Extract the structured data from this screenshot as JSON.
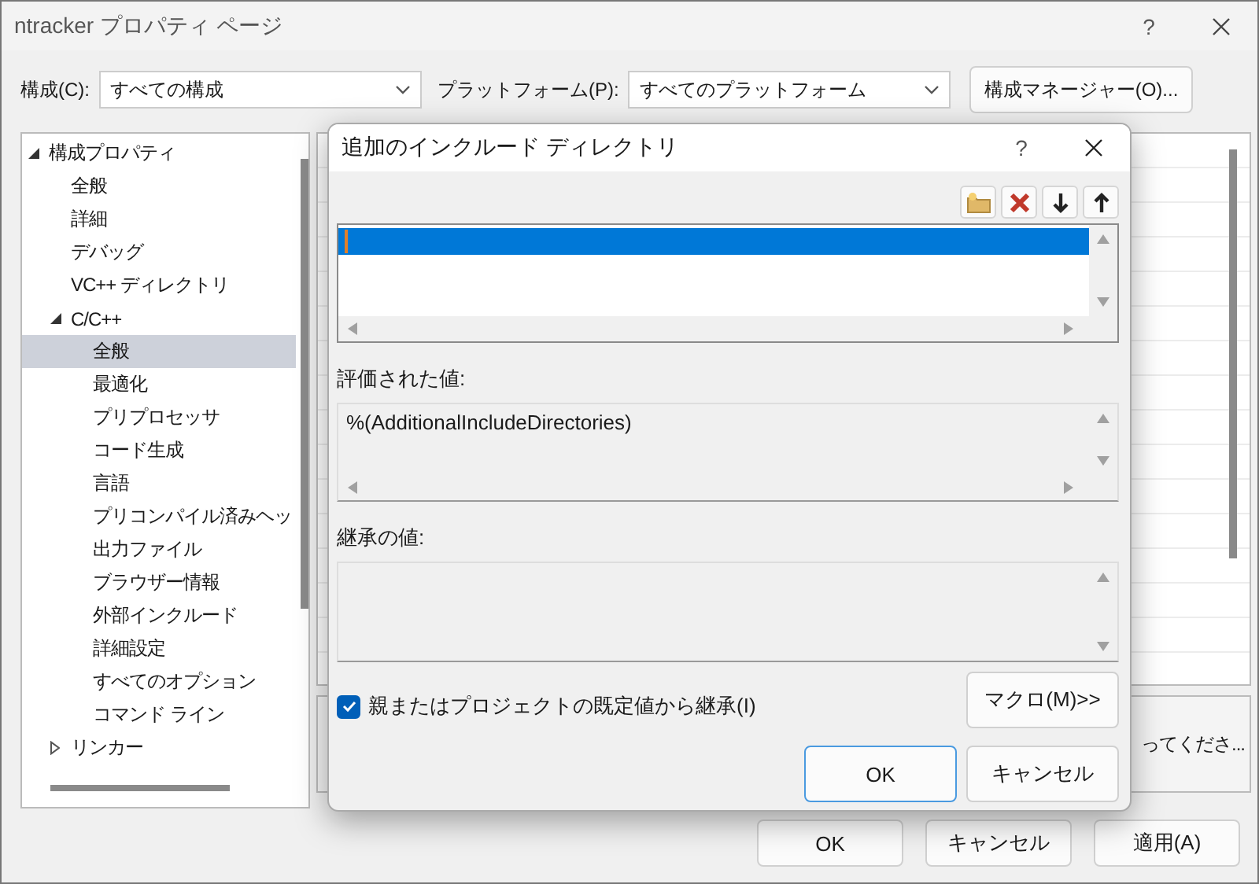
{
  "window": {
    "title": "ntracker プロパティ ページ",
    "help": "?"
  },
  "toolbar": {
    "configuration_label": "構成(C):",
    "configuration_value": "すべての構成",
    "platform_label": "プラットフォーム(P):",
    "platform_value": "すべてのプラットフォーム",
    "manager_button": "構成マネージャー(O)..."
  },
  "tree": [
    {
      "label": "構成プロパティ",
      "expanded": true,
      "selected": false,
      "children": [
        {
          "label": "全般",
          "selected": false
        },
        {
          "label": "詳細",
          "selected": false
        },
        {
          "label": "デバッグ",
          "selected": false
        },
        {
          "label": "VC++ ディレクトリ",
          "selected": false
        },
        {
          "label": "C/C++",
          "expanded": true,
          "selected": false,
          "children": [
            {
              "label": "全般",
              "selected": true
            },
            {
              "label": "最適化",
              "selected": false
            },
            {
              "label": "プリプロセッサ",
              "selected": false
            },
            {
              "label": "コード生成",
              "selected": false
            },
            {
              "label": "言語",
              "selected": false
            },
            {
              "label": "プリコンパイル済みヘッ",
              "selected": false
            },
            {
              "label": "出力ファイル",
              "selected": false
            },
            {
              "label": "ブラウザー情報",
              "selected": false
            },
            {
              "label": "外部インクルード",
              "selected": false
            },
            {
              "label": "詳細設定",
              "selected": false
            },
            {
              "label": "すべてのオプション",
              "selected": false
            },
            {
              "label": "コマンド ライン",
              "selected": false
            }
          ]
        },
        {
          "label": "リンカー",
          "expanded": false,
          "selected": false
        }
      ]
    }
  ],
  "description": "ってくださ...",
  "buttons": [
    "OK",
    "キャンセル",
    "適用(A)"
  ],
  "dialog": {
    "title": "追加のインクルード ディレクトリ",
    "help": "?",
    "list_rows": [
      {
        "selected": true,
        "editing": true
      }
    ],
    "evaluated_label": "評価された値:",
    "evaluated_value": "%(AdditionalIncludeDirectories)",
    "inherited_label": "継承の値:",
    "inherit_checkbox": {
      "label": "親またはプロジェクトの既定値から継承(I)",
      "checked": true
    },
    "macro_button": "マクロ(M)>>",
    "buttons": [
      "OK",
      "キャンセル"
    ]
  }
}
